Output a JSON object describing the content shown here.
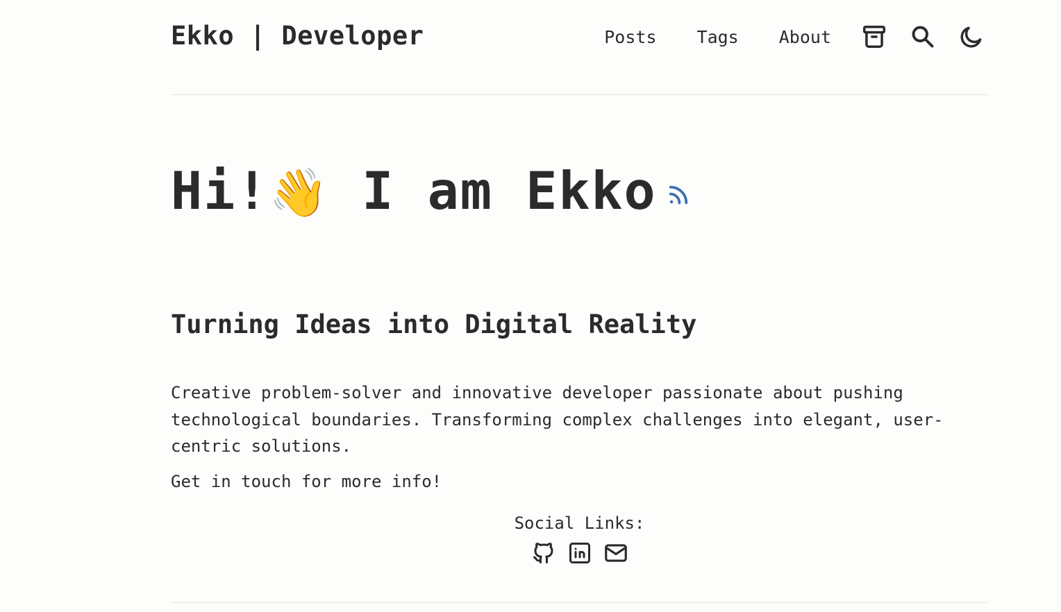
{
  "site": {
    "logo": "Ekko | Developer"
  },
  "nav": {
    "items": [
      {
        "label": "Posts"
      },
      {
        "label": "Tags"
      },
      {
        "label": "About"
      }
    ],
    "icons": [
      "archive-icon",
      "search-icon",
      "moon-icon"
    ]
  },
  "hero": {
    "greeting": "Hi!",
    "wave": "👋",
    "name": " I am Ekko",
    "rss_icon": "rss-icon",
    "accent_color": "#3b6db3"
  },
  "subtitle": "Turning Ideas into Digital Reality",
  "bio": "Creative problem-solver and innovative developer passionate about pushing technological boundaries. Transforming complex challenges into elegant, user-centric solutions.",
  "cta": "Get in touch for more info!",
  "social": {
    "label": "Social Links:",
    "icons": [
      "github-icon",
      "linkedin-icon",
      "mail-icon"
    ]
  }
}
